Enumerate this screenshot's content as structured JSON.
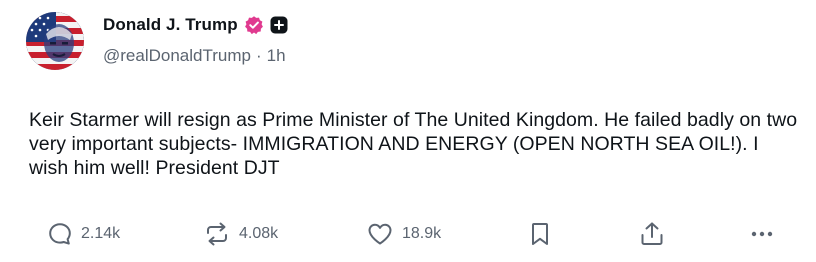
{
  "post": {
    "author": {
      "display_name": "Donald J. Trump",
      "handle": "@realDonaldTrump",
      "separator": "·",
      "time": "1h",
      "avatar_icon": "avatar-flag-portrait-icon",
      "verified_icon": "verified-badge-icon",
      "verified_color": "#e03a8f",
      "badge_icon": "plus-badge-icon"
    },
    "text": "Keir Starmer will resign as Prime Minister of The United Kingdom. He failed badly on two very important subjects- IMMIGRATION AND ENERGY (OPEN NORTH SEA OIL!). I wish him well! President DJT",
    "actions": {
      "reply": {
        "icon": "reply-bubble-icon",
        "count": "2.14k"
      },
      "repost": {
        "icon": "repost-arrows-icon",
        "count": "4.08k"
      },
      "like": {
        "icon": "heart-icon",
        "count": "18.9k"
      },
      "bookmark": {
        "icon": "bookmark-icon"
      },
      "share": {
        "icon": "share-upload-icon"
      },
      "more": {
        "icon": "more-dots-icon"
      }
    },
    "colors": {
      "text": "#0f1419",
      "muted": "#5b6470",
      "background": "#ffffff"
    }
  }
}
